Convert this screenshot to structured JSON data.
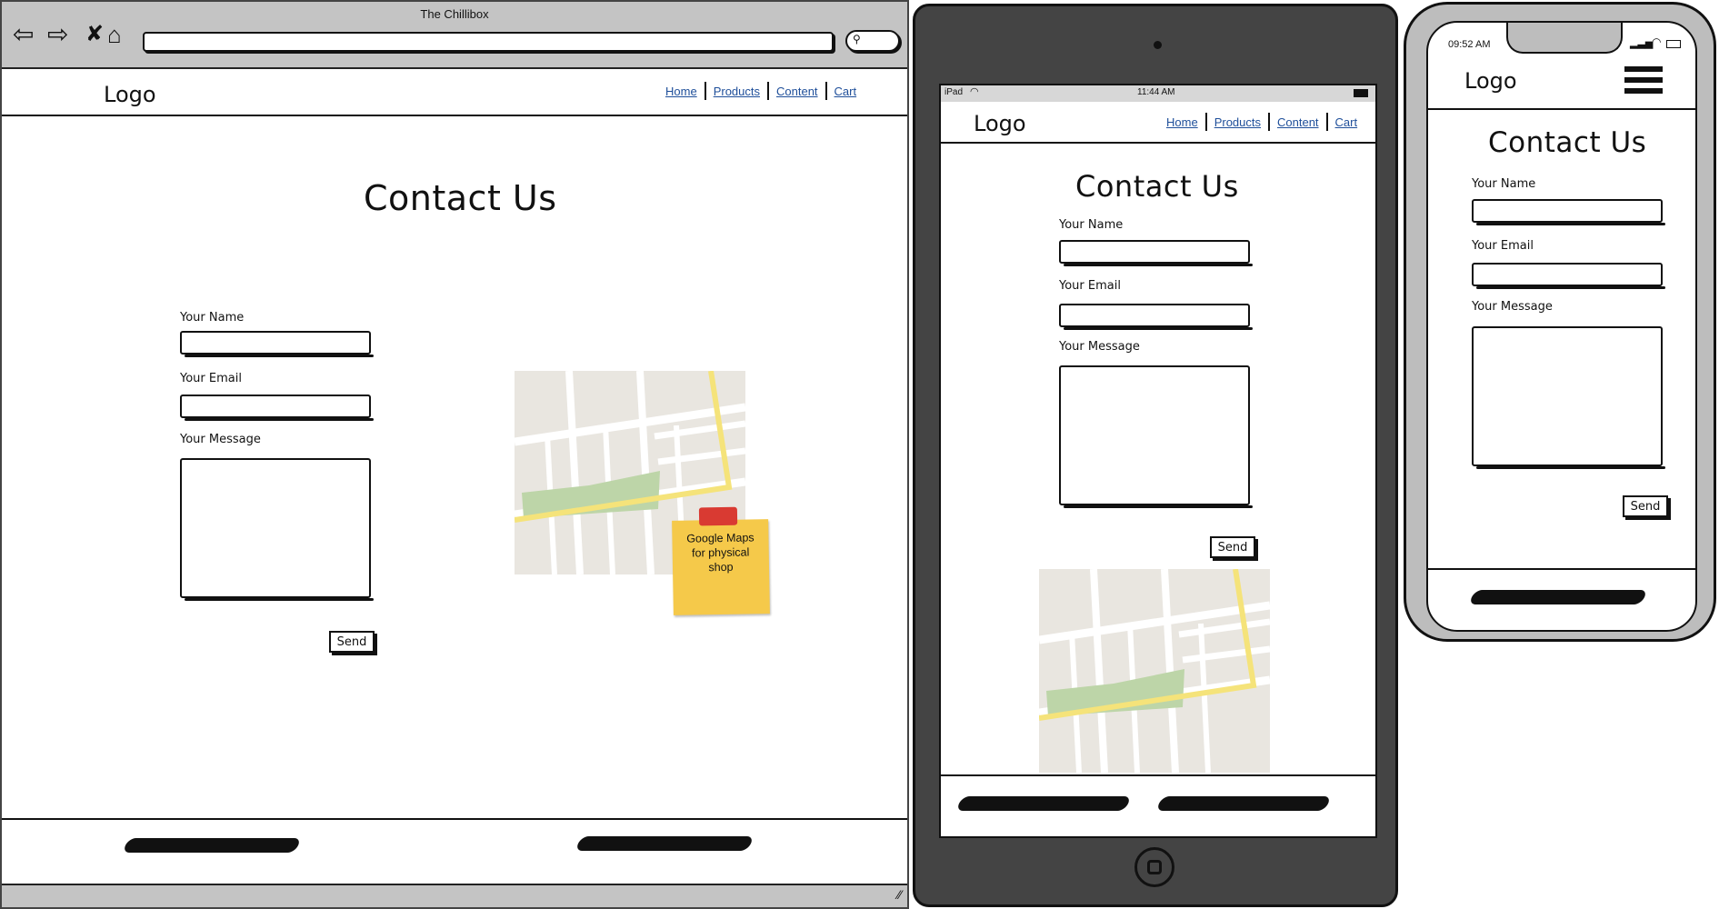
{
  "desktop": {
    "window_title": "The Chillibox",
    "logo": "Logo",
    "nav": [
      "Home",
      "Products",
      "Content",
      "Cart"
    ],
    "heading": "Contact Us",
    "form": {
      "name_label": "Your Name",
      "email_label": "Your Email",
      "message_label": "Your Message",
      "send_label": "Send"
    },
    "sticky_note": "Google Maps\nfor physical\nshop"
  },
  "tablet": {
    "status_carrier": "iPad",
    "status_time": "11:44 AM",
    "logo": "Logo",
    "nav": [
      "Home",
      "Products",
      "Content",
      "Cart"
    ],
    "heading": "Contact Us",
    "form": {
      "name_label": "Your Name",
      "email_label": "Your Email",
      "message_label": "Your Message",
      "send_label": "Send"
    }
  },
  "phone": {
    "status_time": "09:52 AM",
    "logo": "Logo",
    "heading": "Contact Us",
    "form": {
      "name_label": "Your Name",
      "email_label": "Your Email",
      "message_label": "Your Message",
      "send_label": "Send"
    }
  },
  "colors": {
    "link": "#1f4f9a",
    "chrome_gray": "#c4c4c4",
    "device_dark": "#444444",
    "map_bg": "#e9e6e0",
    "map_road": "#ffffff",
    "map_highway": "#f5e37a",
    "map_park": "#bdd5a8",
    "sticky": "#f5c94a",
    "sticky_pin": "#d93a32"
  }
}
